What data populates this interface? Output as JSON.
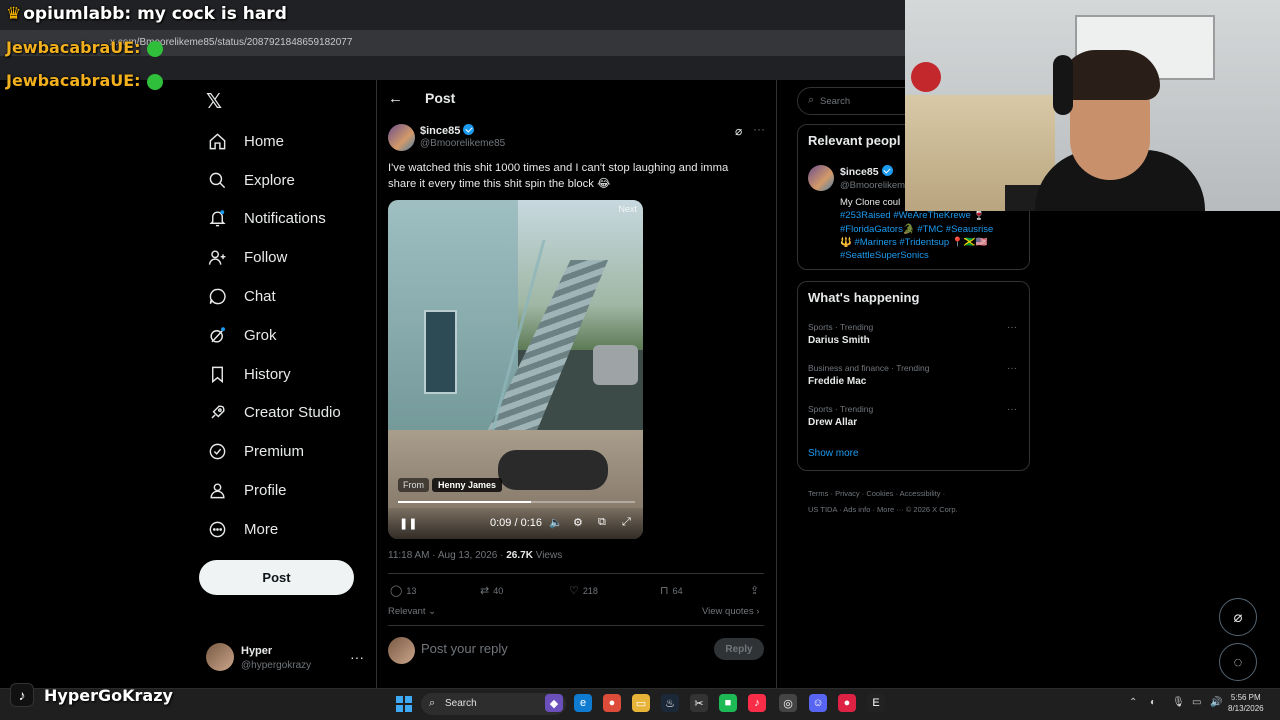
{
  "chat": {
    "line1": "opiumlabb: my cock is hard",
    "line2": "JewbacabraUE:",
    "line3": "JewbacabraUE:"
  },
  "browser": {
    "url": "x.com/Bmoorelikeme85/status/2087921848659182077"
  },
  "sidebar": {
    "items": [
      {
        "label": "Home",
        "icon": "home-icon"
      },
      {
        "label": "Explore",
        "icon": "search-icon"
      },
      {
        "label": "Notifications",
        "icon": "bell-icon"
      },
      {
        "label": "Follow",
        "icon": "follow-icon"
      },
      {
        "label": "Chat",
        "icon": "chat-icon"
      },
      {
        "label": "Grok",
        "icon": "grok-icon"
      },
      {
        "label": "History",
        "icon": "bookmark-icon"
      },
      {
        "label": "Creator Studio",
        "icon": "rocket-icon"
      },
      {
        "label": "Premium",
        "icon": "premium-icon"
      },
      {
        "label": "Profile",
        "icon": "person-icon"
      },
      {
        "label": "More",
        "icon": "more-circle-icon"
      }
    ],
    "post_button": "Post",
    "account": {
      "name": "Hyper",
      "handle": "@hypergokrazy"
    }
  },
  "header": {
    "title": "Post"
  },
  "post": {
    "author_name": "$ince85",
    "author_handle": "@Bmoorelikeme85",
    "text": "I've watched this shit 1000 times and I can't stop laughing and imma share it every time this shit spin the block 😂",
    "video": {
      "next_label": "Next",
      "from_label": "From",
      "from_name": "Henny James",
      "time": "0:09 / 0:16",
      "progress": 0.5625
    },
    "timestamp": "11:18 AM · Aug 13, 2026 · ",
    "views_count": "26.7K",
    "views_label": " Views",
    "stats": {
      "replies": "13",
      "reposts": "40",
      "likes": "218",
      "bookmarks": "64"
    },
    "sort_label": "Relevant",
    "view_quotes": "View quotes",
    "reply_placeholder": "Post your reply",
    "reply_button": "Reply"
  },
  "right": {
    "search_placeholder": "Search",
    "relevant_title": "Relevant peopl",
    "person": {
      "name": "$ince85",
      "handle": "@Bmoorelikem",
      "bio_text": "My Clone coul",
      "bio_tags_1": "#253Raised #WeAreTheKrewe 🍷",
      "bio_tags_2": "#FloridaGators🐊 #TMC #Seausrise",
      "bio_tags_3": "🔱 #Mariners #Tridentsup 📍🇯🇲🇺🇸",
      "bio_tags_4": "#SeattleSuperSonics"
    },
    "happening_title": "What's happening",
    "trends": [
      {
        "category": "Sports · Trending",
        "topic": "Darius Smith"
      },
      {
        "category": "Business and finance · Trending",
        "topic": "Freddie Mac"
      },
      {
        "category": "Sports · Trending",
        "topic": "Drew Allar"
      }
    ],
    "show_more": "Show more",
    "footer_line1": "Terms · Privacy · Cookies · Accessibility ·",
    "footer_line2": "US TIDA · Ads info · More ··· © 2026 X Corp."
  },
  "overlay": {
    "tiktok_name": "HyperGoKrazy"
  },
  "taskbar": {
    "search_label": "Search",
    "time": "5:56 PM",
    "date": "8/13/2026"
  }
}
